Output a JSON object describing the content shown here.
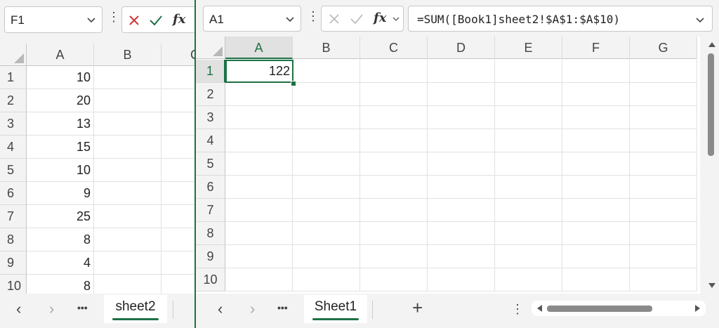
{
  "left_window": {
    "name_box": "F1",
    "columns": [
      "A",
      "B",
      "C"
    ],
    "rows": [
      {
        "row": "1",
        "a": "10"
      },
      {
        "row": "2",
        "a": "20"
      },
      {
        "row": "3",
        "a": "13"
      },
      {
        "row": "4",
        "a": "15"
      },
      {
        "row": "5",
        "a": "10"
      },
      {
        "row": "6",
        "a": "9"
      },
      {
        "row": "7",
        "a": "25"
      },
      {
        "row": "8",
        "a": "8"
      },
      {
        "row": "9",
        "a": "4"
      },
      {
        "row": "10",
        "a": "8"
      }
    ],
    "sheet_tab": "sheet2",
    "more_label": "•••"
  },
  "right_window": {
    "name_box": "A1",
    "formula": "=SUM([Book1]sheet2!$A$1:$A$10)",
    "fx_label": "fx",
    "columns": [
      "A",
      "B",
      "C",
      "D",
      "E",
      "F",
      "G"
    ],
    "rows": [
      "1",
      "2",
      "3",
      "4",
      "5",
      "6",
      "7",
      "8",
      "9",
      "10"
    ],
    "cell_a1": "122",
    "sheet_tab": "Sheet1",
    "more_label": "•••",
    "add_label": "+"
  },
  "colors": {
    "accent": "#1e7145",
    "cancel": "#d13438",
    "enter": "#1e7145"
  }
}
